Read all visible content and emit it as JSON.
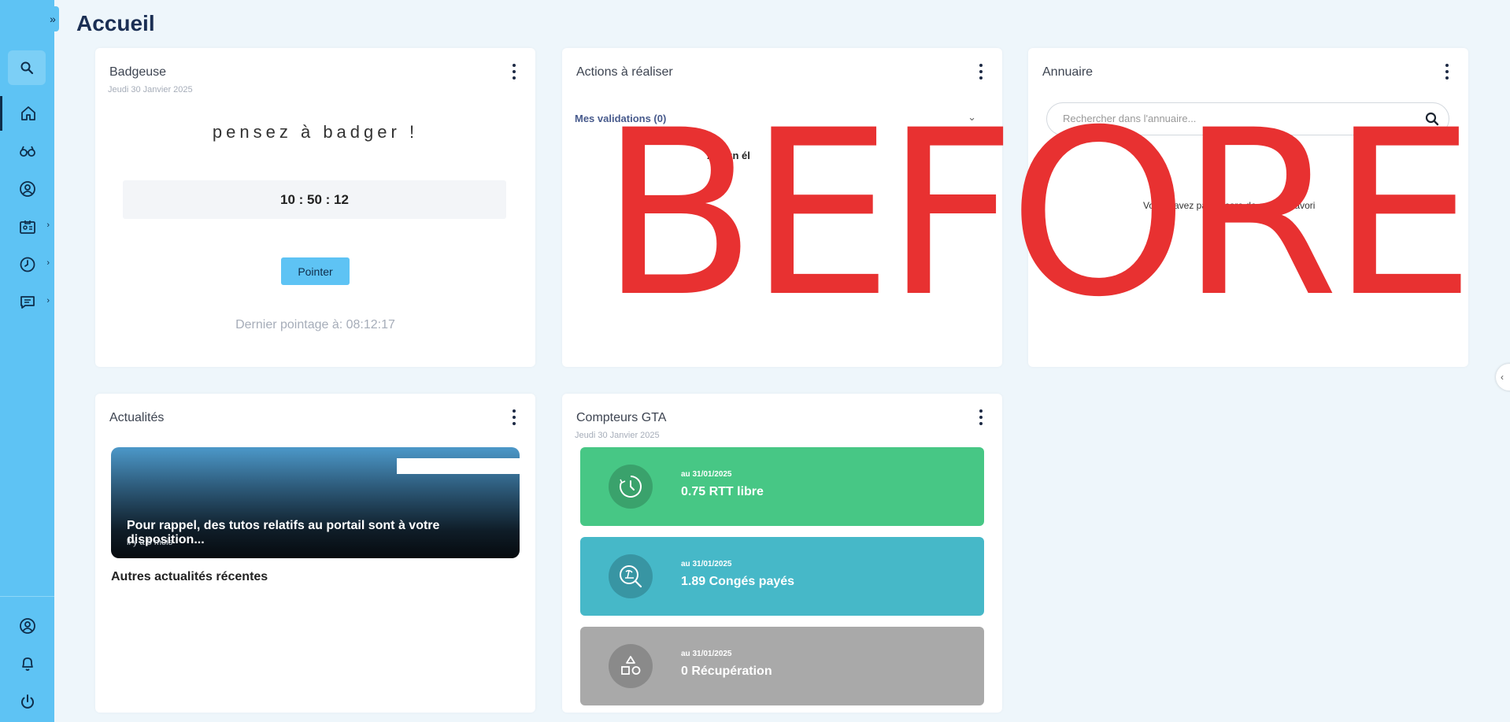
{
  "page": {
    "title": "Accueil"
  },
  "sidebar": {
    "toggle": "»",
    "items": [
      {
        "icon": "search-icon"
      },
      {
        "icon": "home-icon"
      },
      {
        "icon": "binoculars-icon"
      },
      {
        "icon": "user-circle-icon"
      },
      {
        "icon": "id-card-icon"
      },
      {
        "icon": "clock-icon"
      },
      {
        "icon": "chat-icon"
      },
      {
        "icon": "profile-icon"
      },
      {
        "icon": "bell-icon"
      },
      {
        "icon": "power-icon"
      }
    ]
  },
  "badgeuse": {
    "title": "Badgeuse",
    "date": "Jeudi 30 Janvier 2025",
    "message": "pensez à badger !",
    "clock": "10 : 50 : 12",
    "button": "Pointer",
    "last_punch": "Dernier pointage à: 08:12:17"
  },
  "actions": {
    "title": "Actions à réaliser",
    "validations": "Mes validations (0)",
    "empty": "Aucun él"
  },
  "annuaire": {
    "title": "Annuaire",
    "search_placeholder": "Rechercher dans l'annuaire...",
    "empty": "Vous n'avez pas encore de contact favori"
  },
  "actualites": {
    "title": "Actualités",
    "news": [
      {
        "text": "Pour rappel, des tutos relatifs au portail sont à votre disposition...",
        "time": "il y a 5 mois"
      }
    ],
    "more": "Autres actualités récentes"
  },
  "compteurs": {
    "title": "Compteurs GTA",
    "date": "Jeudi 30 Janvier 2025",
    "items": [
      {
        "date": "au 31/01/2025",
        "value": "0.75 RTT libre",
        "color": "#47c785",
        "icon_bg": "#3aa26c",
        "icon": "clock-icon"
      },
      {
        "date": "au 31/01/2025",
        "value": "1.89 Congés payés",
        "color": "#46b8c8",
        "icon_bg": "#3895a3",
        "icon": "beach-icon"
      },
      {
        "date": "au 31/01/2025",
        "value": "0 Récupération",
        "color": "#a9a9a9",
        "icon_bg": "#8a8a8a",
        "icon": "shapes-icon"
      }
    ]
  },
  "overlay": {
    "text": "BEFORE"
  }
}
